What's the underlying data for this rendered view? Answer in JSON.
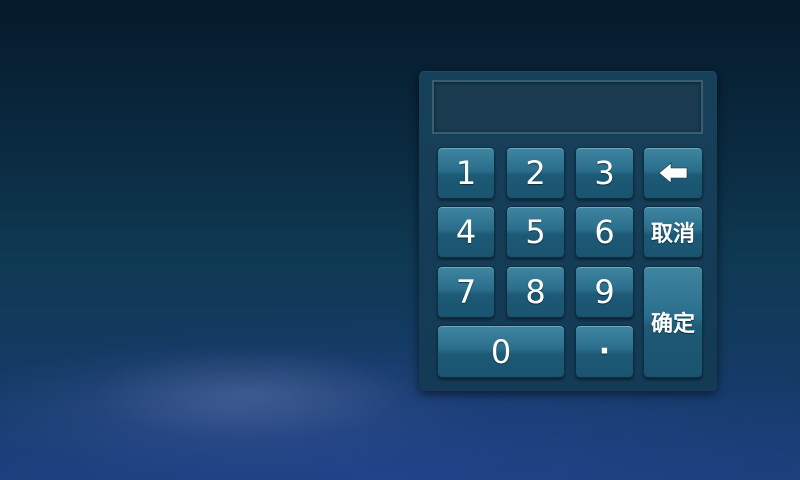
{
  "keypad": {
    "display_value": "",
    "keys": {
      "k1": "1",
      "k2": "2",
      "k3": "3",
      "k4": "4",
      "k5": "5",
      "k6": "6",
      "k7": "7",
      "k8": "8",
      "k9": "9",
      "k0": "0",
      "dot": "·",
      "cancel": "取消",
      "confirm": "确定",
      "backspace_icon": "backspace-arrow-icon"
    }
  },
  "colors": {
    "key_top": "#3f86a1",
    "key_bottom": "#195370",
    "panel": "#17405a",
    "display_bg": "#1a3b50",
    "display_border": "#34606f"
  }
}
